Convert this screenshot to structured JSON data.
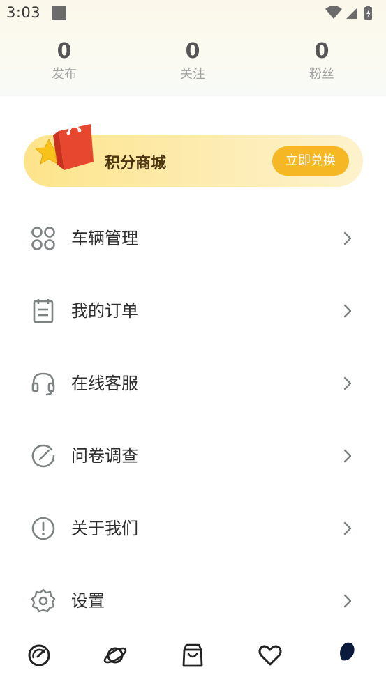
{
  "status_bar": {
    "time": "3:03"
  },
  "stats": [
    {
      "count": "0",
      "label": "发布"
    },
    {
      "count": "0",
      "label": "关注"
    },
    {
      "count": "0",
      "label": "粉丝"
    }
  ],
  "banner": {
    "title": "积分商城",
    "button": "立即兑换",
    "icon": "shopping-bag-icon"
  },
  "menu": [
    {
      "label": "车辆管理",
      "icon": "grid-icon"
    },
    {
      "label": "我的订单",
      "icon": "clipboard-icon"
    },
    {
      "label": "在线客服",
      "icon": "headset-icon"
    },
    {
      "label": "问卷调查",
      "icon": "survey-check-icon"
    },
    {
      "label": "关于我们",
      "icon": "info-icon"
    },
    {
      "label": "设置",
      "icon": "gear-icon"
    }
  ],
  "tabbar": [
    {
      "icon": "dashboard-icon"
    },
    {
      "icon": "planet-icon"
    },
    {
      "icon": "shopping-bag-icon"
    },
    {
      "icon": "heart-icon"
    },
    {
      "icon": "profile-icon",
      "active": true
    }
  ],
  "colors": {
    "accent": "#f5b724",
    "banner_start": "#fde48a",
    "icon_gray": "#7d8283",
    "text_dark": "#2e2e2e",
    "label_gray": "#a2a2a2"
  }
}
